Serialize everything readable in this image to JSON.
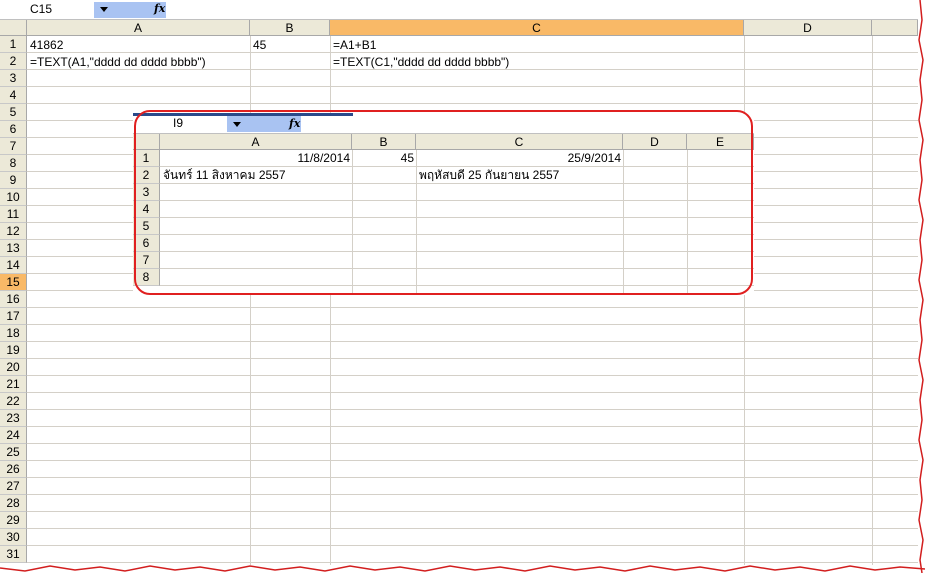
{
  "formula_bar": {
    "name_box": "C15",
    "fx_label": "fx"
  },
  "columns": [
    {
      "label": "A"
    },
    {
      "label": "B"
    },
    {
      "label": "C"
    },
    {
      "label": "D"
    },
    {
      "label": ""
    }
  ],
  "rows": [
    "1",
    "2",
    "3",
    "4",
    "5",
    "6",
    "7",
    "8",
    "9",
    "10",
    "11",
    "12",
    "13",
    "14",
    "15",
    "16",
    "17",
    "18",
    "19",
    "20",
    "21",
    "22",
    "23",
    "24",
    "25",
    "26",
    "27",
    "28",
    "29",
    "30",
    "31"
  ],
  "selected": {
    "column": "C",
    "row": "15"
  },
  "cells": {
    "A1": "41862",
    "B1": "45",
    "C1": "=A1+B1",
    "A2": "=TEXT(A1,\"dddd dd dddd bbbb\")",
    "C2": "=TEXT(C1,\"dddd dd dddd bbbb\")"
  },
  "embedded": {
    "name_box": "I9",
    "fx_label": "fx",
    "columns": [
      "A",
      "B",
      "C",
      "D",
      "E"
    ],
    "rows": [
      "1",
      "2",
      "3",
      "4",
      "5",
      "6",
      "7",
      "8"
    ],
    "cells": {
      "A1": "11/8/2014",
      "B1": "45",
      "C1": "25/9/2014",
      "A2": "จันทร์ 11 สิงหาคม 2557",
      "C2": "พฤหัสบดี 25 กันยายน 2557"
    }
  },
  "colors": {
    "header_bg": "#ece9d8",
    "selected_header": "#f9b967",
    "highlight": "#e02020",
    "namebox_dropdown": "#a9c3f2"
  }
}
